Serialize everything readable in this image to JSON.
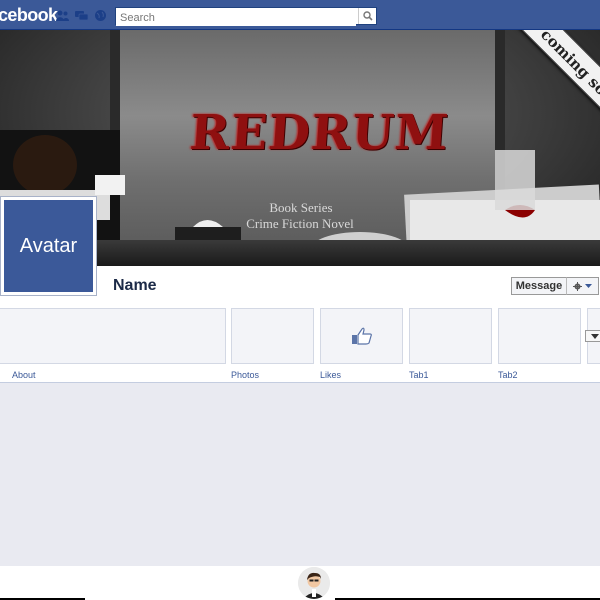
{
  "header": {
    "logo_text": "cebook",
    "search_placeholder": "Search",
    "brand_color": "#3b5998"
  },
  "cover": {
    "title": "REDRUM",
    "subtitle_line1": "Book Series",
    "subtitle_line2": "Crime Fiction Novel",
    "ribbon": "coming soo"
  },
  "profile": {
    "avatar_label": "Avatar",
    "name": "Name",
    "message_label": "Message"
  },
  "tabs": [
    {
      "label": "About"
    },
    {
      "label": "Photos"
    },
    {
      "label": "Likes"
    },
    {
      "label": "Tab1"
    },
    {
      "label": "Tab2"
    }
  ]
}
